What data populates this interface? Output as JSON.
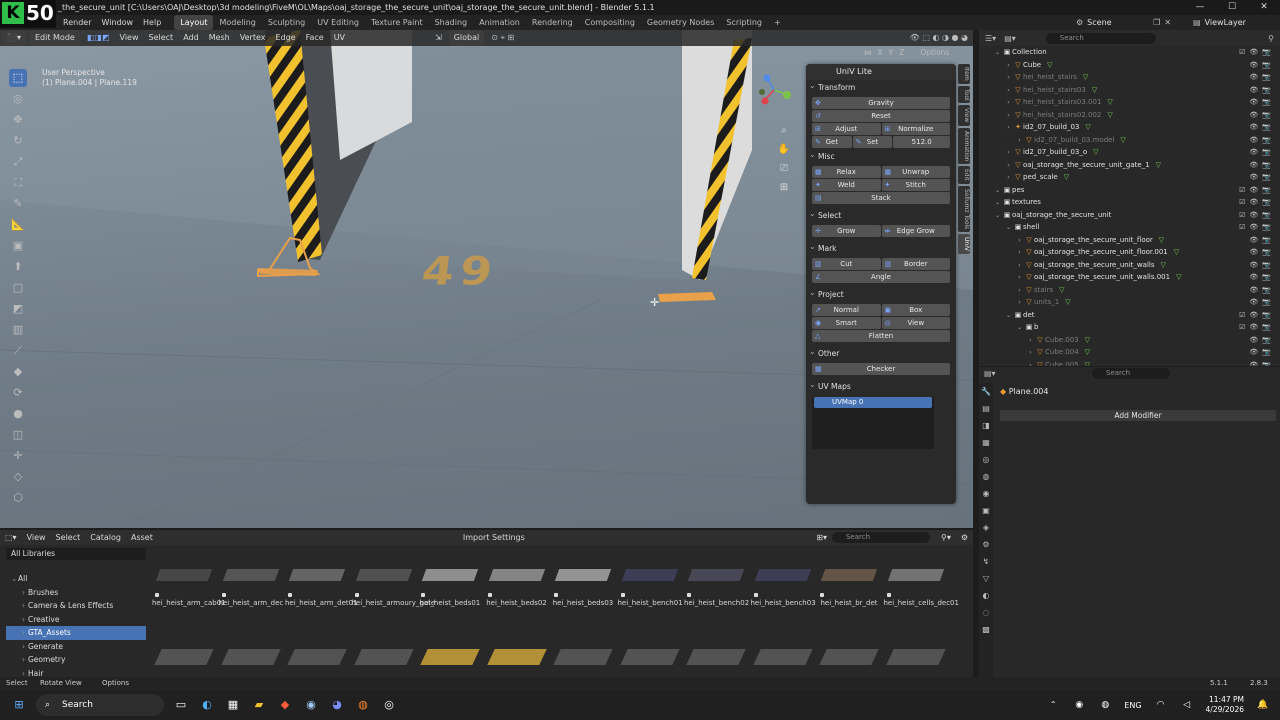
{
  "window": {
    "title": "_the_secure_unit [C:\\Users\\OAJ\\Desktop\\3d modeling\\FiveM\\OL\\Maps\\oaj_storage_the_secure_unit\\oaj_storage_the_secure_unit.blend] - Blender 5.1.1"
  },
  "overlay_logo": {
    "letter": "K",
    "number": "50"
  },
  "menu": [
    "Render",
    "Window",
    "Help"
  ],
  "workspaces": [
    "Layout",
    "Modeling",
    "Sculpting",
    "UV Editing",
    "Texture Paint",
    "Shading",
    "Animation",
    "Rendering",
    "Compositing",
    "Geometry Nodes",
    "Scripting"
  ],
  "active_workspace": "Layout",
  "scene": {
    "label": "Scene",
    "view_layer": "ViewLayer"
  },
  "viewport_header": {
    "mode": "Edit Mode",
    "items": [
      "View",
      "Select",
      "Add",
      "Mesh",
      "Vertex",
      "Edge",
      "Face",
      "UV"
    ],
    "transform_orientation": "Global",
    "options": "Options",
    "axes": [
      "X",
      "Y",
      "Z"
    ]
  },
  "viewport_info": {
    "line1": "User Perspective",
    "line2": "(1) Plane.004 | Plane.119"
  },
  "floor_marking": "49",
  "npanel": {
    "title": "UniV Lite",
    "transform": {
      "label": "Transform",
      "gravity": "Gravity",
      "reset": "Reset",
      "adjust": "Adjust",
      "normalize": "Normalize",
      "get": "Get",
      "set": "Set",
      "value": "512.0"
    },
    "misc": {
      "label": "Misc",
      "relax": "Relax",
      "unwrap": "Unwrap",
      "weld": "Weld",
      "stitch": "Stitch",
      "stack": "Stack"
    },
    "select": {
      "label": "Select",
      "grow": "Grow",
      "edge_grow": "Edge Grow"
    },
    "mark": {
      "label": "Mark",
      "cut": "Cut",
      "border": "Border",
      "angle": "Angle"
    },
    "project": {
      "label": "Project",
      "normal": "Normal",
      "box": "Box",
      "smart": "Smart",
      "view": "View",
      "flatten": "Flatten"
    },
    "other": {
      "label": "Other",
      "checker": "Checker"
    },
    "uvmaps": {
      "label": "UV Maps",
      "item": "UVMap 0"
    }
  },
  "side_tabs": [
    "Item",
    "Tool",
    "View",
    "Animation",
    "Edit",
    "Sollumz Tools",
    "UniV"
  ],
  "outliner": {
    "search_placeholder": "Search",
    "rows": [
      {
        "depth": 0,
        "name": "Collection",
        "type": "collection",
        "dim": false
      },
      {
        "depth": 1,
        "name": "Cube",
        "type": "mesh",
        "dim": false
      },
      {
        "depth": 1,
        "name": "hei_heist_stairs",
        "type": "mesh",
        "dim": true
      },
      {
        "depth": 1,
        "name": "hei_heist_stairs03",
        "type": "mesh",
        "dim": true
      },
      {
        "depth": 1,
        "name": "hei_heist_stairs03.001",
        "type": "mesh",
        "dim": true
      },
      {
        "depth": 1,
        "name": "hei_heist_stairs02.002",
        "type": "mesh",
        "dim": true
      },
      {
        "depth": 1,
        "name": "id2_07_build_03",
        "type": "armature",
        "dim": false
      },
      {
        "depth": 2,
        "name": "id2_07_build_03.model",
        "type": "mesh",
        "dim": true
      },
      {
        "depth": 1,
        "name": "id2_07_build_03_o",
        "type": "mesh",
        "dim": false
      },
      {
        "depth": 1,
        "name": "oaj_storage_the_secure_unit_gate_1",
        "type": "mesh",
        "dim": false
      },
      {
        "depth": 1,
        "name": "ped_scale",
        "type": "mesh",
        "dim": false
      },
      {
        "depth": 0,
        "name": "pes",
        "type": "collection",
        "dim": false
      },
      {
        "depth": 0,
        "name": "textures",
        "type": "collection",
        "dim": false
      },
      {
        "depth": 0,
        "name": "oaj_storage_the_secure_unit",
        "type": "collection",
        "dim": false
      },
      {
        "depth": 1,
        "name": "shell",
        "type": "collection",
        "dim": false
      },
      {
        "depth": 2,
        "name": "oaj_storage_the_secure_unit_floor",
        "type": "mesh",
        "dim": false
      },
      {
        "depth": 2,
        "name": "oaj_storage_the_secure_unit_floor.001",
        "type": "mesh",
        "dim": false
      },
      {
        "depth": 2,
        "name": "oaj_storage_the_secure_unit_walls",
        "type": "mesh",
        "dim": false
      },
      {
        "depth": 2,
        "name": "oaj_storage_the_secure_unit_walls.001",
        "type": "mesh",
        "dim": false
      },
      {
        "depth": 2,
        "name": "stairs",
        "type": "mesh",
        "dim": true
      },
      {
        "depth": 2,
        "name": "units_1",
        "type": "mesh",
        "dim": true
      },
      {
        "depth": 1,
        "name": "det",
        "type": "collection",
        "dim": false
      },
      {
        "depth": 2,
        "name": "b",
        "type": "collection",
        "dim": false
      },
      {
        "depth": 3,
        "name": "Cube.003",
        "type": "mesh",
        "dim": true
      },
      {
        "depth": 3,
        "name": "Cube.004",
        "type": "mesh",
        "dim": true
      },
      {
        "depth": 3,
        "name": "Cube.005",
        "type": "mesh",
        "dim": true
      }
    ]
  },
  "properties": {
    "search_placeholder": "Search",
    "object": "Plane.004",
    "add_modifier": "Add Modifier"
  },
  "asset_browser": {
    "header": [
      "View",
      "Select",
      "Catalog",
      "Asset"
    ],
    "import": "Import Settings",
    "search_placeholder": "Search",
    "library": "All Libraries",
    "categories": [
      {
        "name": "All",
        "top": true,
        "active": false
      },
      {
        "name": "Brushes",
        "top": false,
        "active": false
      },
      {
        "name": "Camera & Lens Effects",
        "top": false,
        "active": false
      },
      {
        "name": "Creative",
        "top": false,
        "active": false
      },
      {
        "name": "GTA_Assets",
        "top": false,
        "active": true
      },
      {
        "name": "Generate",
        "top": false,
        "active": false
      },
      {
        "name": "Geometry",
        "top": false,
        "active": false
      },
      {
        "name": "Hair",
        "top": false,
        "active": false
      }
    ],
    "assets": [
      "hei_heist_arm_cab01",
      "hei_heist_arm_dec",
      "hei_heist_arm_det01",
      "hei_heist_armoury_gate",
      "hei_heist_beds01",
      "hei_heist_beds02",
      "hei_heist_beds03",
      "hei_heist_bench01",
      "hei_heist_bench02",
      "hei_heist_bench03",
      "hei_heist_br_det",
      "hei_heist_cells_dec01"
    ]
  },
  "statusbar": {
    "select": "Select",
    "rotate": "Rotate View",
    "options": "Options",
    "version": "5.1.1",
    "right": "2.8.3"
  },
  "taskbar": {
    "search": "Search",
    "lang": "ENG",
    "time": "11:47 PM",
    "date": "4/29/2026"
  },
  "colors": {
    "accent": "#4772b3",
    "orange": "#e89a35",
    "green": "#7dd35a"
  }
}
